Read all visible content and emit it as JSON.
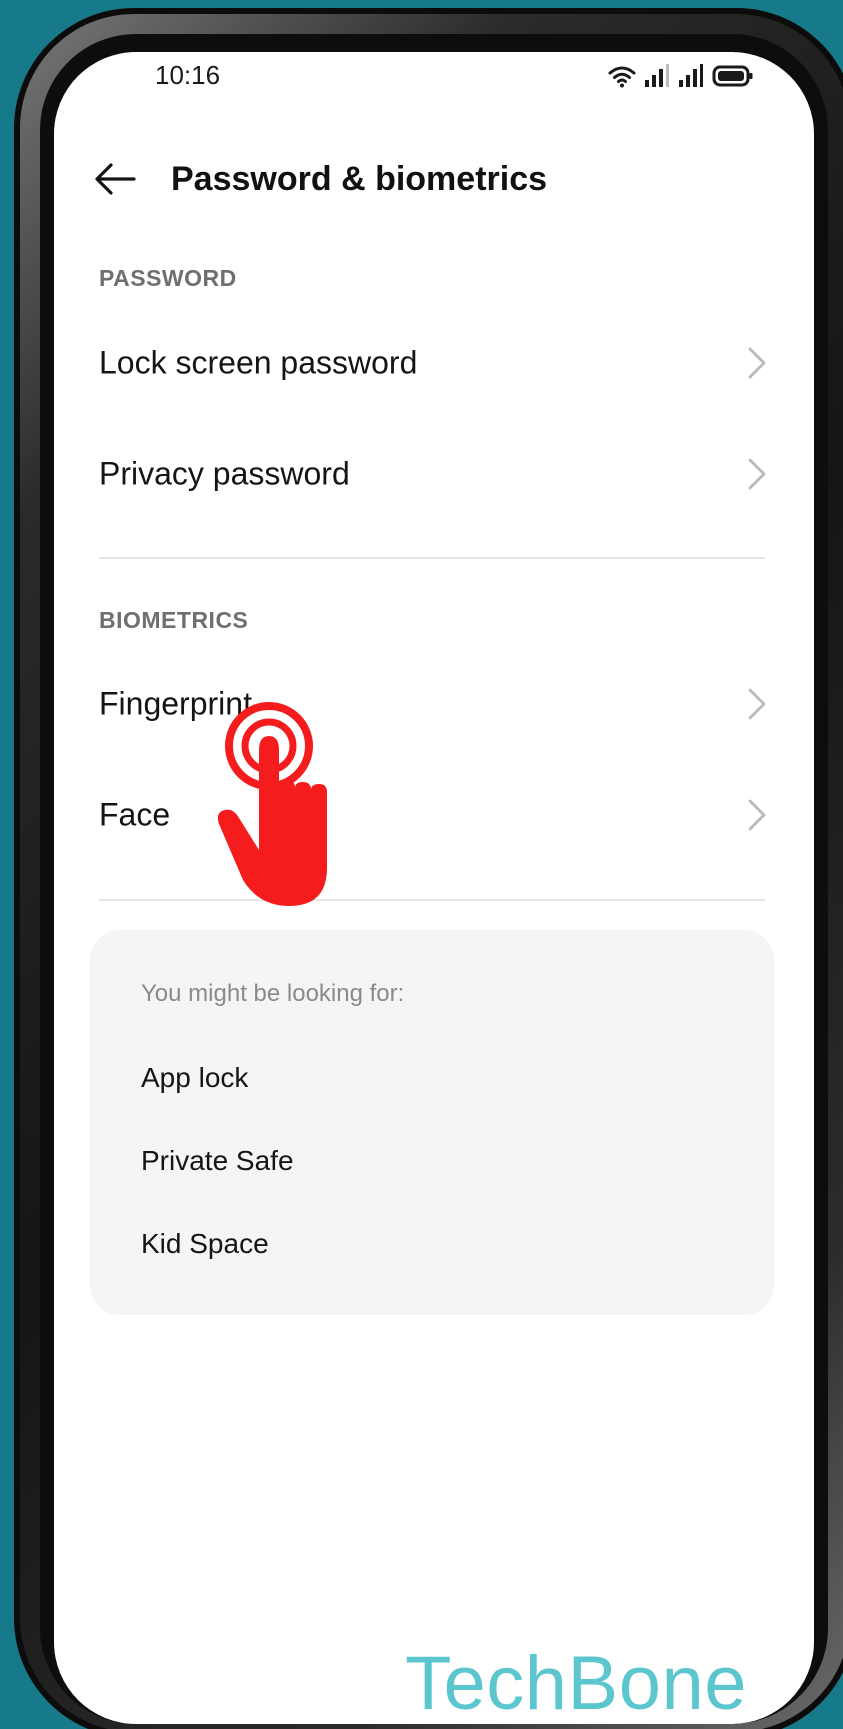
{
  "status_bar": {
    "time": "10:16",
    "icons": [
      "wifi-icon",
      "signal-icon",
      "signal-icon",
      "battery-icon"
    ]
  },
  "header": {
    "back_icon": "arrow-left",
    "title": "Password & biometrics"
  },
  "sections": {
    "password": {
      "label": "PASSWORD",
      "items": [
        {
          "label": "Lock screen password"
        },
        {
          "label": "Privacy password"
        }
      ]
    },
    "biometrics": {
      "label": "BIOMETRICS",
      "items": [
        {
          "label": "Fingerprint"
        },
        {
          "label": "Face"
        }
      ]
    }
  },
  "suggestions": {
    "heading": "You might be looking for:",
    "items": [
      "App lock",
      "Private Safe",
      "Kid Space"
    ]
  },
  "overlay": {
    "tap_indicator": "tap-hand-icon",
    "watermark": "TechBone"
  },
  "colors": {
    "background": "#167a8a",
    "tap_indicator": "#f41c1c",
    "watermark": "#5cc6cf",
    "card": "#f5f5f5"
  }
}
